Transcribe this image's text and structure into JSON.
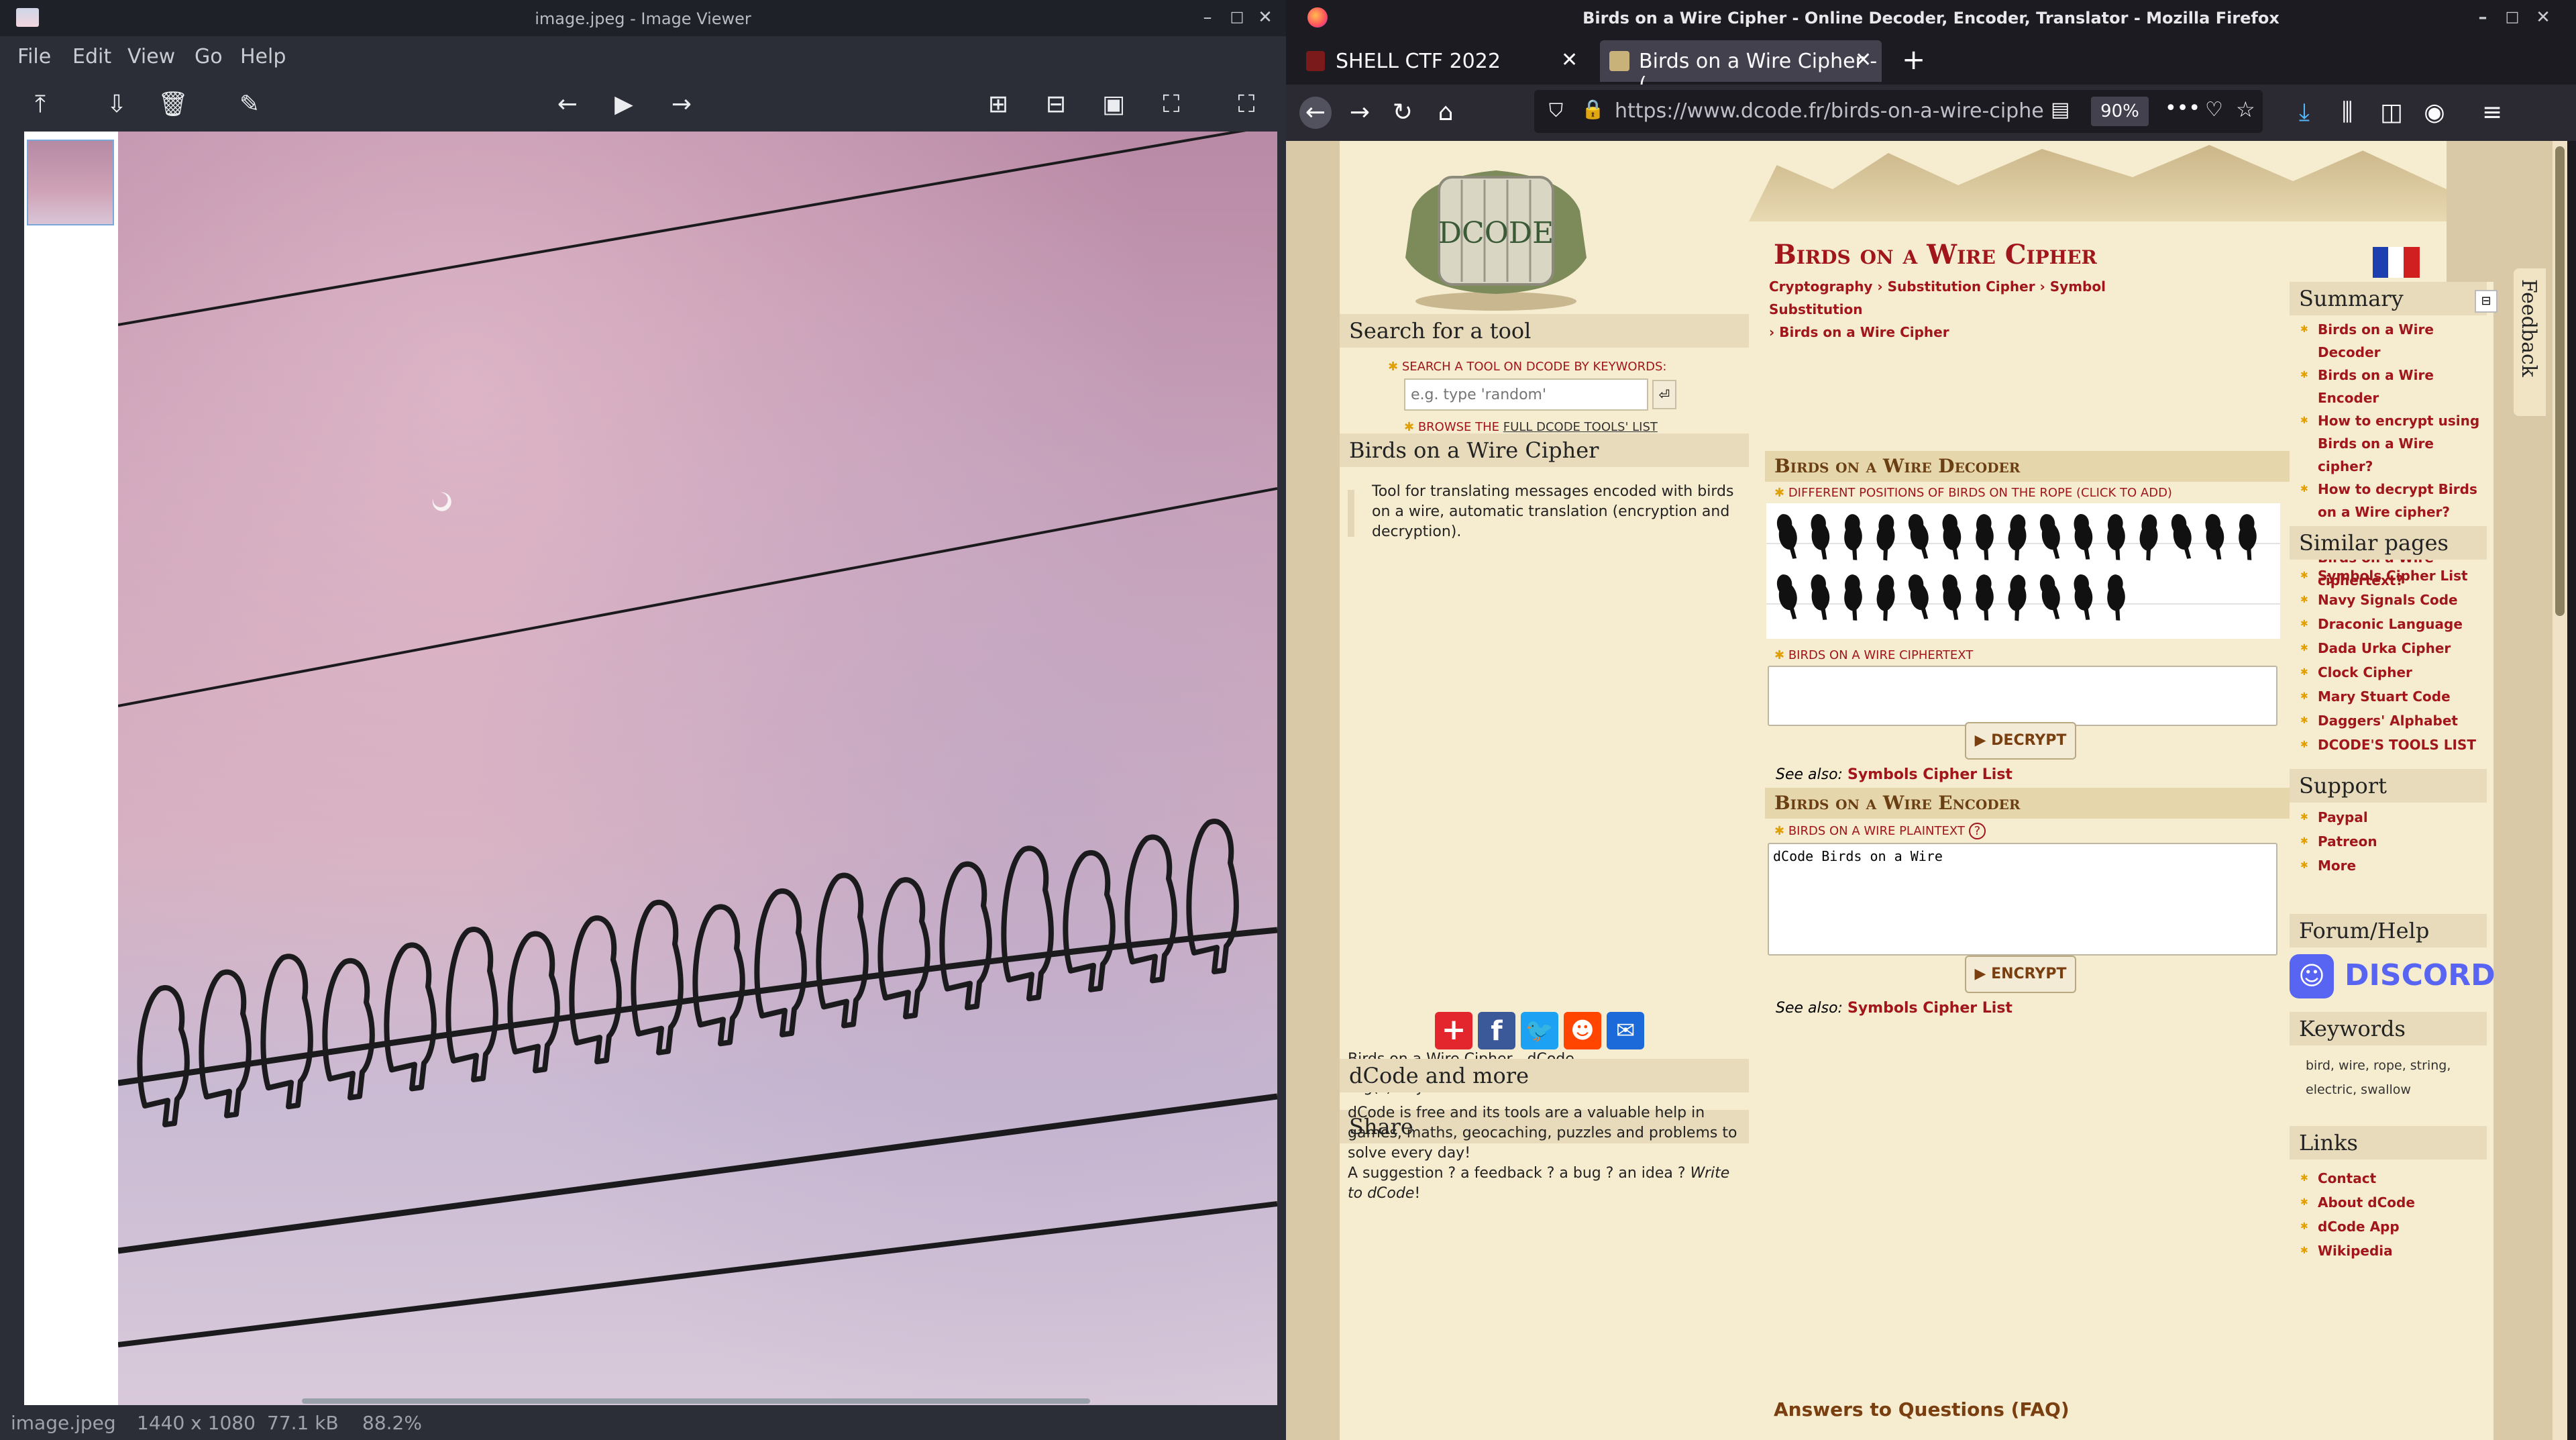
{
  "image_viewer": {
    "title": "image.jpeg - Image Viewer",
    "menu": [
      "File",
      "Edit",
      "View",
      "Go",
      "Help"
    ],
    "status": {
      "filename": "image.jpeg",
      "dimensions": "1440 x 1080",
      "size": "77.1 kB",
      "zoom": "88.2%"
    },
    "toolbar_icons": [
      "upload-icon",
      "save-icon",
      "delete-icon",
      "edit-icon",
      "back-icon",
      "play-icon",
      "forward-icon",
      "zoom-in-icon",
      "zoom-out-icon",
      "actual-size-icon",
      "fit-icon",
      "fullscreen-icon"
    ]
  },
  "firefox": {
    "window_title": "Birds on a Wire Cipher - Online Decoder, Encoder, Translator - Mozilla Firefox",
    "tabs": [
      {
        "label": "SHELL CTF 2022"
      },
      {
        "label": "Birds on a Wire Cipher - ("
      }
    ],
    "url": "https://www.dcode.fr/birds-on-a-wire-ciphe",
    "zoom": "90%"
  },
  "dcode": {
    "logo_text": "DCODE",
    "search": {
      "header": "Search for a tool",
      "keywords_label": "SEARCH A TOOL ON DCODE BY KEYWORDS:",
      "placeholder": "e.g. type 'random'",
      "browse_prefix": "BROWSE THE",
      "browse_link": "FULL DCODE TOOLS' LIST"
    },
    "tool_box": {
      "header": "Birds on a Wire Cipher",
      "description": "Tool for translating messages encoded with birds on a wire, automatic translation (encryption and decryption).",
      "credit_prefix": "Birds on a Wire Cipher - ",
      "credit_link": "dCode",
      "tags": "Tag(s) : Symbol Substitution"
    },
    "share": {
      "header": "Share"
    },
    "more": {
      "header": "dCode and more",
      "text1": "dCode is free and its tools are a valuable help in games, maths, geocaching, puzzles and problems to solve every day!",
      "text2": "A suggestion ? a feedback ? a bug ? an idea ? ",
      "text2_link": "Write to dCode",
      "text2_end": "!"
    },
    "main": {
      "title": "Birds on a Wire Cipher",
      "breadcrumb": [
        "Cryptography",
        "Substitution Cipher",
        "Symbol Substitution",
        "Birds on a Wire Cipher"
      ],
      "decoder": {
        "header": "Birds on a Wire Decoder",
        "positions_label": "DIFFERENT POSITIONS OF BIRDS ON THE ROPE (CLICK TO ADD)",
        "ciphertext_label": "BIRDS ON A WIRE CIPHERTEXT",
        "button": "▶ DECRYPT",
        "see_also": "See also:",
        "see_also_link": "Symbols Cipher List"
      },
      "encoder": {
        "header": "Birds on a Wire Encoder",
        "plaintext_label": "BIRDS ON A WIRE PLAINTEXT",
        "plaintext_value": "dCode Birds on a Wire",
        "button": "▶ ENCRYPT",
        "see_also": "See also:",
        "see_also_link": "Symbols Cipher List"
      },
      "faq": "Answers to Questions (FAQ)"
    },
    "right": {
      "summary_header": "Summary",
      "summary": [
        "Birds on a Wire Decoder",
        "Birds on a Wire Encoder",
        "How to encrypt using Birds on a Wire cipher?",
        "How to decrypt Birds on a Wire cipher?",
        "How to recognize a Birds on a Wire ciphertext?"
      ],
      "similar_header": "Similar pages",
      "similar": [
        "Symbols Cipher List",
        "Navy Signals Code",
        "Draconic Language",
        "Dada Urka Cipher",
        "Clock Cipher",
        "Mary Stuart Code",
        "Daggers' Alphabet",
        "DCODE'S TOOLS LIST"
      ],
      "support_header": "Support",
      "support": [
        "Paypal",
        "Patreon",
        "More"
      ],
      "forum_header": "Forum/Help",
      "discord": "DISCORD",
      "keywords_header": "Keywords",
      "keywords": "bird, wire, rope, string, electric, swallow",
      "links_header": "Links",
      "links": [
        "Contact",
        "About dCode",
        "dCode App",
        "Wikipedia"
      ],
      "feedback": "Feedback"
    }
  }
}
